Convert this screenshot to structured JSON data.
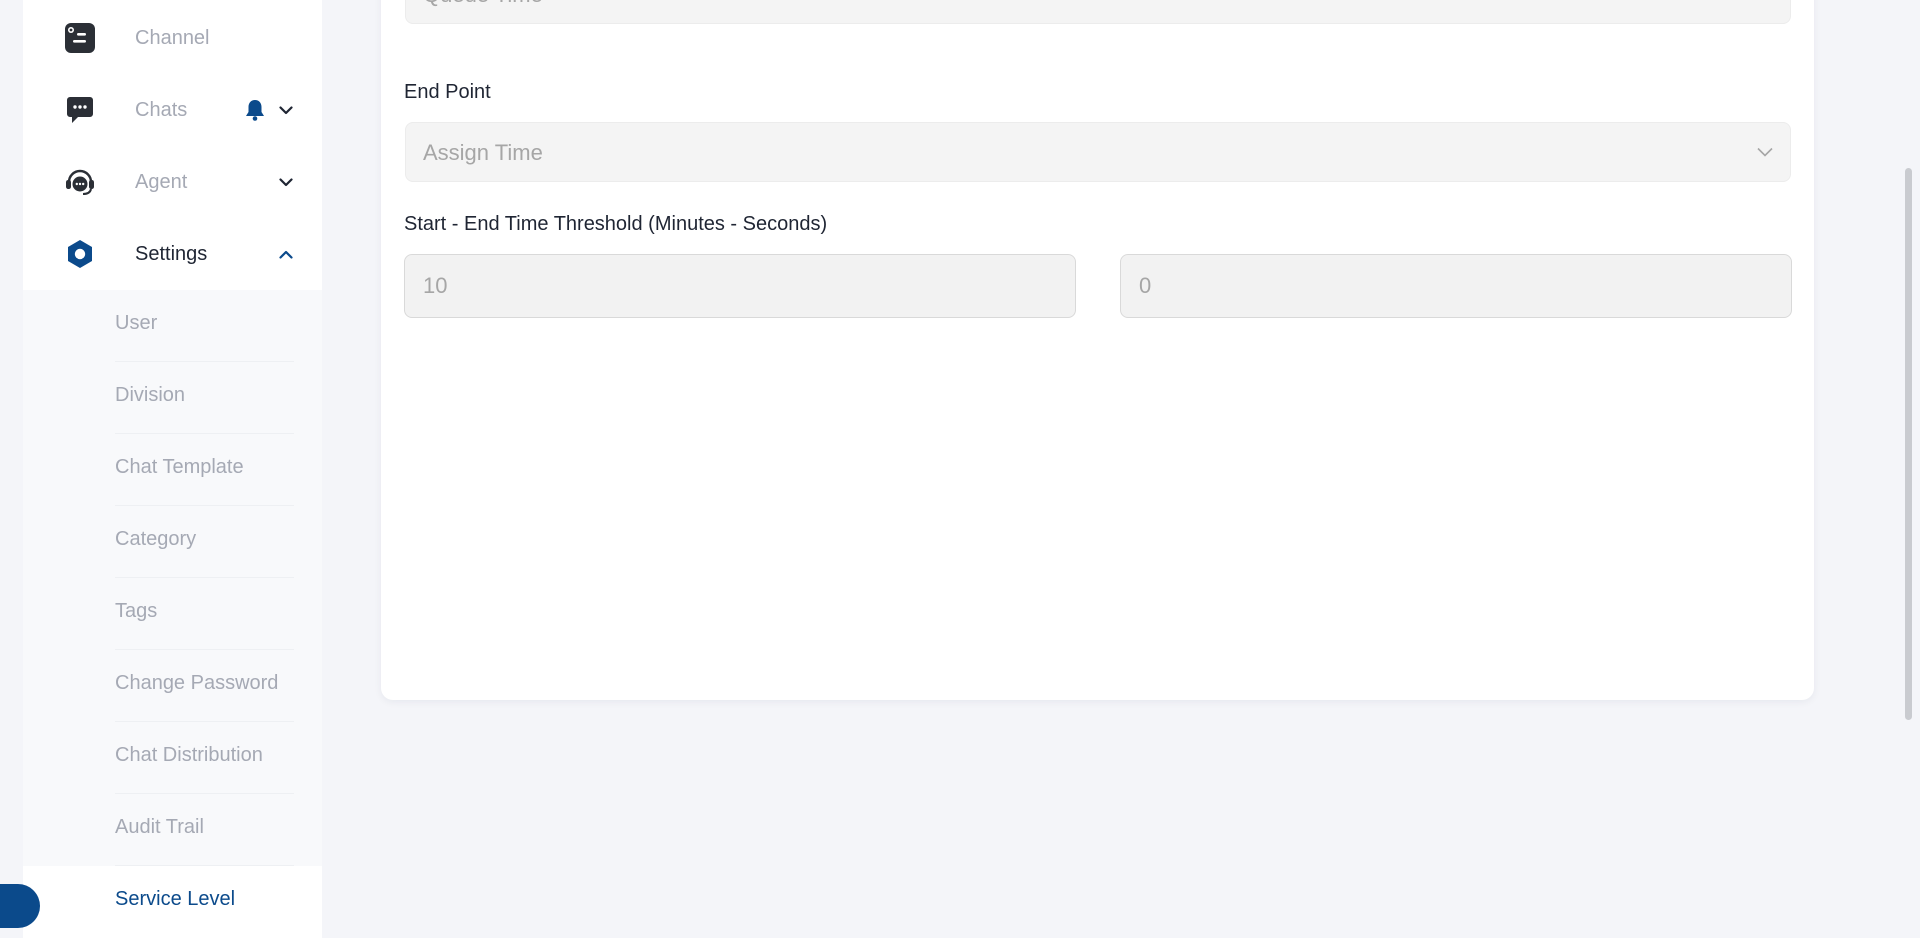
{
  "sidebar": {
    "items": [
      {
        "label": "Channel",
        "icon": "channel-icon"
      },
      {
        "label": "Chats",
        "icon": "chat-bubble-icon",
        "badge_icon": "bell-icon"
      },
      {
        "label": "Agent",
        "icon": "headset-icon"
      },
      {
        "label": "Settings",
        "icon": "hexagon-settings-icon"
      }
    ],
    "submenu": [
      {
        "label": "User"
      },
      {
        "label": "Division"
      },
      {
        "label": "Chat Template"
      },
      {
        "label": "Category"
      },
      {
        "label": "Tags"
      },
      {
        "label": "Change Password"
      },
      {
        "label": "Chat Distribution"
      },
      {
        "label": "Audit Trail"
      },
      {
        "label": "Service Level"
      }
    ],
    "active_submenu": "Service Level"
  },
  "form": {
    "start_point_value": "Queue Time",
    "end_point_label": "End Point",
    "end_point_value": "Assign Time",
    "threshold_label": "Start - End Time Threshold (Minutes - Seconds)",
    "threshold_minutes": "10",
    "threshold_seconds": "0"
  },
  "colors": {
    "accent": "#0b4a8b",
    "icon_dark": "#2b2f36",
    "bell": "#0b4a8b"
  }
}
